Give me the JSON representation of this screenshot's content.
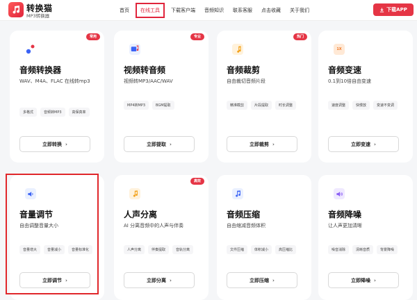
{
  "header": {
    "brand_title": "转换猫",
    "brand_subtitle": "MP3转换器",
    "nav": [
      "首页",
      "在线工具",
      "下载客户端",
      "音频知识",
      "联系客服",
      "点击收藏",
      "关于我们"
    ],
    "active_nav": "在线工具",
    "download_label": "下载APP"
  },
  "colors": {
    "accent": "#e53545",
    "highlight": "#e0262a"
  },
  "cards": [
    {
      "title": "音频转换器",
      "desc": "WAV、M4A、FLAC 在线转mp3",
      "badge": "常用",
      "tags": [
        "多格式",
        "音频转MP3",
        "高保真率"
      ],
      "button": "立即转换",
      "icon": "audio-dots-icon"
    },
    {
      "title": "视频转音频",
      "desc": "视频转MP3/AAC/WAV",
      "badge": "专业",
      "tags": [
        "MP4转MP3",
        "BGM提取"
      ],
      "button": "立即提取",
      "icon": "video-note-icon"
    },
    {
      "title": "音频裁剪",
      "desc": "自由裁切音频片段",
      "badge": "热门",
      "tags": [
        "精准截剪",
        "片段提取",
        "时长调整"
      ],
      "button": "立即裁剪",
      "icon": "scissors-icon"
    },
    {
      "title": "音频变速",
      "desc": "0.1到10倍自由变速",
      "badge": "",
      "tags": [
        "速度调整",
        "快慢放",
        "变速不变调"
      ],
      "button": "立即变速",
      "icon": "speed-1x-icon",
      "icon_text": "1X"
    },
    {
      "title": "音量调节",
      "desc": "自由调整音量大小",
      "badge": "",
      "tags": [
        "音量增大",
        "音量减小",
        "音量标准化"
      ],
      "button": "立即调节",
      "icon": "volume-icon"
    },
    {
      "title": "人声分离",
      "desc": "AI 分离音频中的人声与伴奏",
      "badge": "高效",
      "tags": [
        "人声分离",
        "伴奏提取",
        "音轨分离"
      ],
      "button": "立即分离",
      "icon": "vocal-separate-icon"
    },
    {
      "title": "音频压缩",
      "desc": "自由缩减音频体积",
      "badge": "",
      "tags": [
        "文件压缩",
        "体积减小",
        "高压缩比"
      ],
      "button": "立即压缩",
      "icon": "compress-icon"
    },
    {
      "title": "音频降噪",
      "desc": "让人声更加清晰",
      "badge": "",
      "tags": [
        "噪音消除",
        "清晰音质",
        "背景降噪"
      ],
      "button": "立即降噪",
      "icon": "denoise-icon"
    }
  ]
}
